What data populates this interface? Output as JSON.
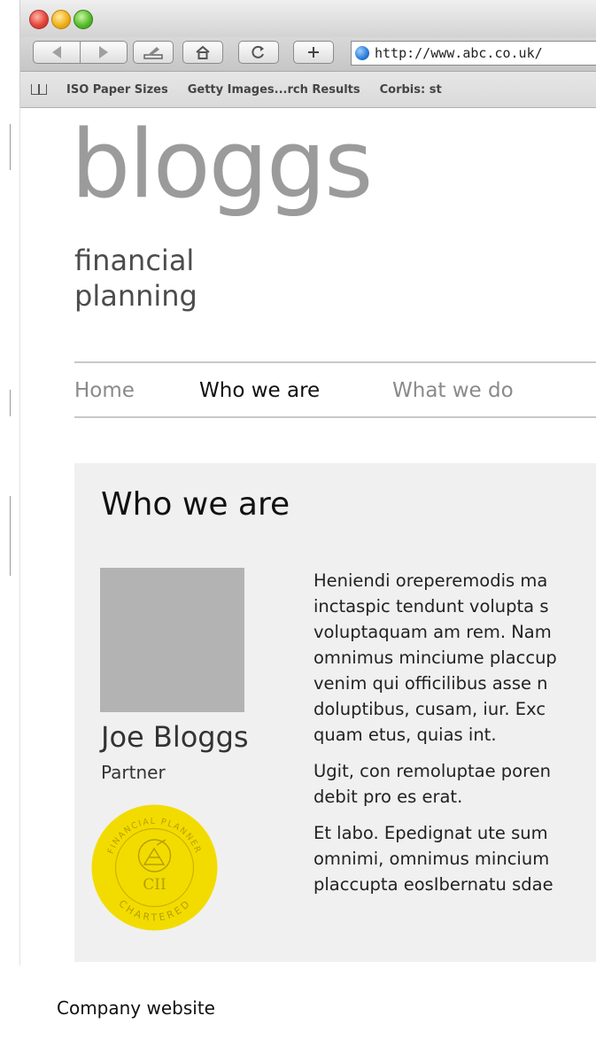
{
  "browser": {
    "url": "http://www.abc.co.uk/",
    "bookmarks": [
      "ISO Paper Sizes",
      "Getty Images...rch Results",
      "Corbis: st"
    ]
  },
  "site": {
    "logo": "bloggs",
    "tagline_line1": "financial",
    "tagline_line2": "planning",
    "nav": [
      {
        "label": "Home",
        "active": false
      },
      {
        "label": "Who we are",
        "active": true
      },
      {
        "label": "What we do",
        "active": false
      }
    ]
  },
  "section": {
    "heading": "Who we are",
    "person": {
      "name": "Joe Bloggs",
      "role": "Partner"
    },
    "badge": {
      "top": "FINANCIAL PLANNER",
      "center": "CII",
      "bottom": "CHARTERED",
      "color": "#f2dc00"
    },
    "paragraphs": [
      [
        "Heniendi oreperemodis ma",
        "inctaspic tendunt volupta s",
        "voluptaquam am rem. Nam",
        "omnimus minciume placcup",
        "venim qui officilibus asse n",
        "doluptibus, cusam, iur. Exc",
        "quam etus, quias int."
      ],
      [
        "Ugit, con remoluptae poren",
        "debit pro es erat."
      ],
      [
        "Et labo. Epedignat ute sum",
        "omnimi, omnimus mincium",
        "placcupta eosIbernatu sdae"
      ]
    ]
  },
  "caption": "Company website"
}
